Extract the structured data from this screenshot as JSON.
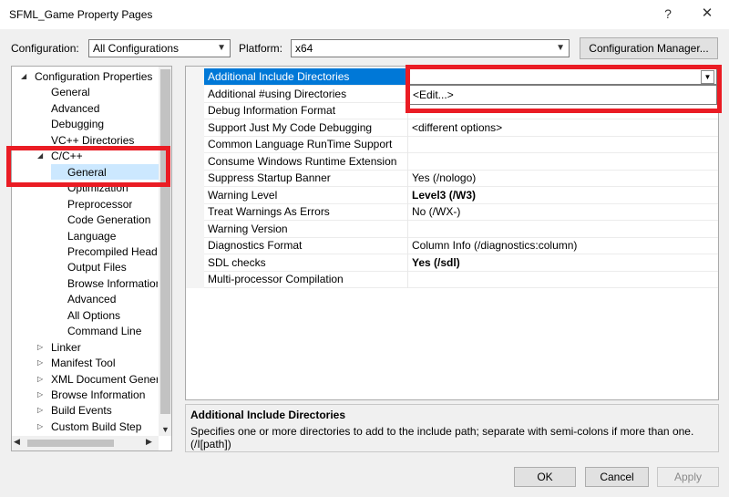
{
  "window": {
    "title": "SFML_Game Property Pages",
    "help_glyph": "?",
    "close_glyph": "✕"
  },
  "config_row": {
    "configuration_label": "Configuration:",
    "configuration_value": "All Configurations",
    "platform_label": "Platform:",
    "platform_value": "x64",
    "manager_button": "Configuration Manager..."
  },
  "tree": {
    "items": [
      {
        "label": "Configuration Properties",
        "expanded": true
      },
      {
        "label": "General"
      },
      {
        "label": "Advanced"
      },
      {
        "label": "Debugging"
      },
      {
        "label": "VC++ Directories"
      },
      {
        "label": "C/C++",
        "expanded": true
      },
      {
        "label": "General",
        "selected": true
      },
      {
        "label": "Optimization"
      },
      {
        "label": "Preprocessor"
      },
      {
        "label": "Code Generation"
      },
      {
        "label": "Language"
      },
      {
        "label": "Precompiled Heade"
      },
      {
        "label": "Output Files"
      },
      {
        "label": "Browse Information"
      },
      {
        "label": "Advanced"
      },
      {
        "label": "All Options"
      },
      {
        "label": "Command Line"
      },
      {
        "label": "Linker",
        "expanded": false
      },
      {
        "label": "Manifest Tool",
        "expanded": false
      },
      {
        "label": "XML Document Genera",
        "expanded": false
      },
      {
        "label": "Browse Information",
        "expanded": false
      },
      {
        "label": "Build Events",
        "expanded": false
      },
      {
        "label": "Custom Build Step",
        "expanded": false
      }
    ]
  },
  "properties": [
    {
      "name": "Additional Include Directories",
      "value": "",
      "selected": true
    },
    {
      "name": "Additional #using Directories",
      "value": ""
    },
    {
      "name": "Debug Information Format",
      "value": ""
    },
    {
      "name": "Support Just My Code Debugging",
      "value": "<different options>"
    },
    {
      "name": "Common Language RunTime Support",
      "value": ""
    },
    {
      "name": "Consume Windows Runtime Extension",
      "value": ""
    },
    {
      "name": "Suppress Startup Banner",
      "value": "Yes (/nologo)"
    },
    {
      "name": "Warning Level",
      "value": "Level3 (/W3)",
      "bold": true
    },
    {
      "name": "Treat Warnings As Errors",
      "value": "No (/WX-)"
    },
    {
      "name": "Warning Version",
      "value": ""
    },
    {
      "name": "Diagnostics Format",
      "value": "Column Info (/diagnostics:column)"
    },
    {
      "name": "SDL checks",
      "value": "Yes (/sdl)",
      "bold": true
    },
    {
      "name": "Multi-processor Compilation",
      "value": ""
    }
  ],
  "dropdown": {
    "edit_item": "<Edit...>"
  },
  "description": {
    "title": "Additional Include Directories",
    "text": "Specifies one or more directories to add to the include path; separate with semi-colons if more than one. (/I[path])"
  },
  "buttons": {
    "ok": "OK",
    "cancel": "Cancel",
    "apply": "Apply"
  },
  "colors": {
    "selection": "#0078d7",
    "highlight_frame": "#ea1c24",
    "tree_selected": "#cce8ff"
  }
}
